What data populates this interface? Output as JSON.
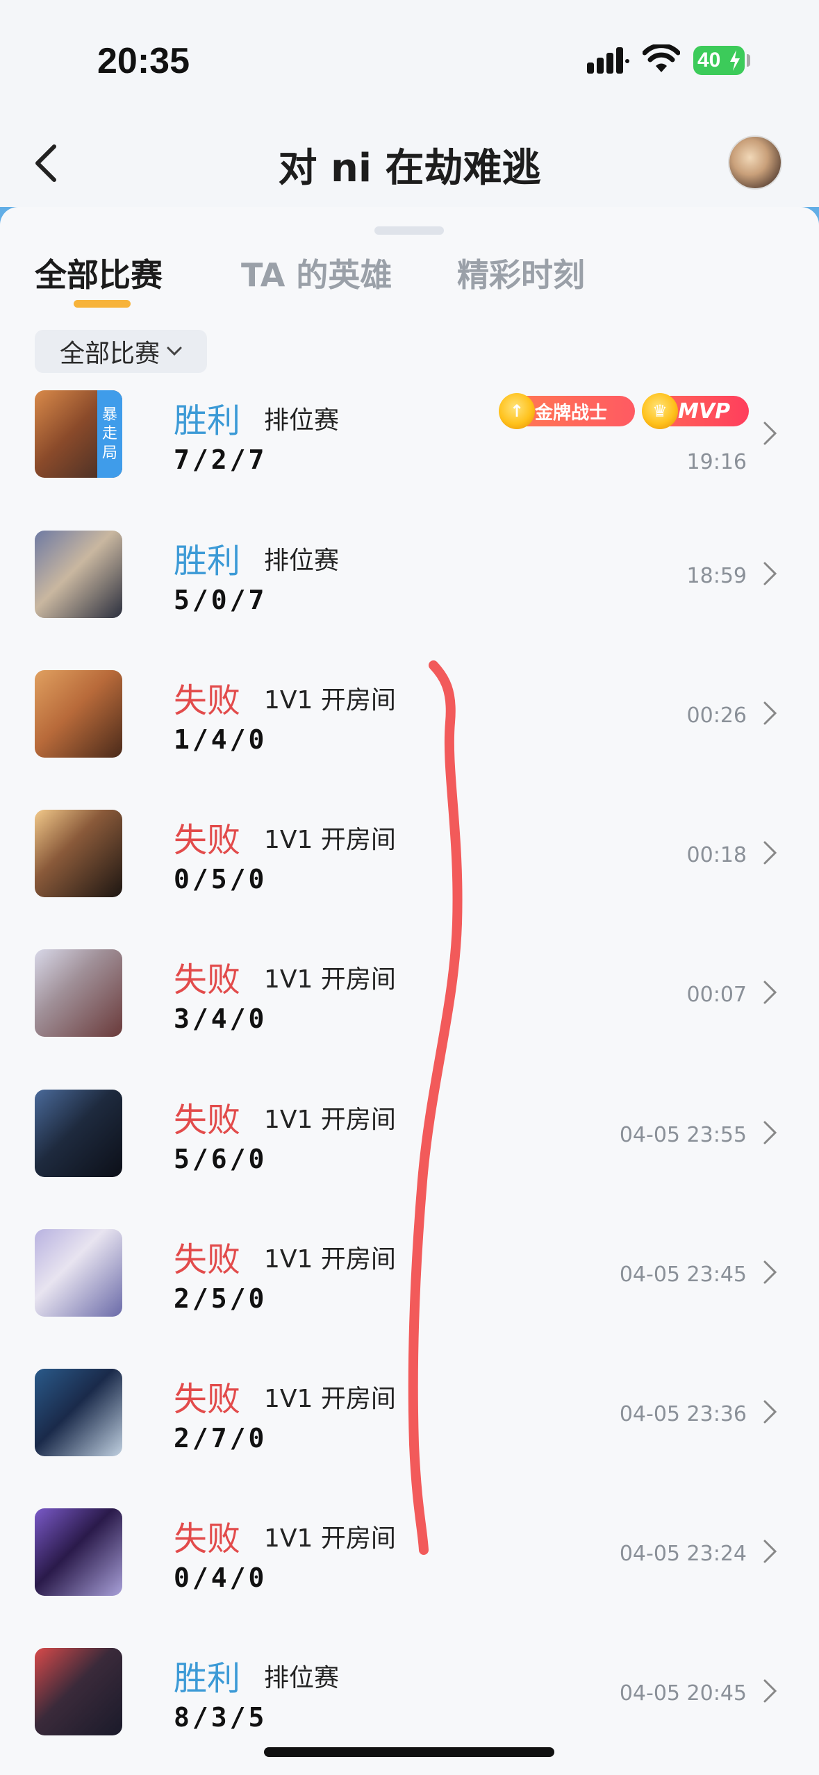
{
  "status_bar": {
    "time": "20:35",
    "battery": "40"
  },
  "header": {
    "title": "对 ni 在劫难逃"
  },
  "tabs": [
    {
      "label": "全部比赛",
      "active": true
    },
    {
      "label": "TA 的英雄",
      "active": false
    },
    {
      "label": "精彩时刻",
      "active": false
    }
  ],
  "filter": {
    "label": "全部比赛"
  },
  "colors": {
    "win": "#3c9ad6",
    "lose": "#e24b4b",
    "accent": "#f7b33a",
    "annotation": "#f25a5a"
  },
  "matches": [
    {
      "result": "胜利",
      "outcome": "win",
      "mode": "排位赛",
      "kda": "7/2/7",
      "time": "19:16",
      "tag": [
        "暴",
        "走",
        "局"
      ],
      "badges": [
        "金牌战士",
        "MVP"
      ]
    },
    {
      "result": "胜利",
      "outcome": "win",
      "mode": "排位赛",
      "kda": "5/0/7",
      "time": "18:59"
    },
    {
      "result": "失败",
      "outcome": "lose",
      "mode": "1V1 开房间",
      "kda": "1/4/0",
      "time": "00:26"
    },
    {
      "result": "失败",
      "outcome": "lose",
      "mode": "1V1 开房间",
      "kda": "0/5/0",
      "time": "00:18"
    },
    {
      "result": "失败",
      "outcome": "lose",
      "mode": "1V1 开房间",
      "kda": "3/4/0",
      "time": "00:07"
    },
    {
      "result": "失败",
      "outcome": "lose",
      "mode": "1V1 开房间",
      "kda": "5/6/0",
      "time": "04-05 23:55"
    },
    {
      "result": "失败",
      "outcome": "lose",
      "mode": "1V1 开房间",
      "kda": "2/5/0",
      "time": "04-05 23:45"
    },
    {
      "result": "失败",
      "outcome": "lose",
      "mode": "1V1 开房间",
      "kda": "2/7/0",
      "time": "04-05 23:36"
    },
    {
      "result": "失败",
      "outcome": "lose",
      "mode": "1V1 开房间",
      "kda": "0/4/0",
      "time": "04-05 23:24"
    },
    {
      "result": "胜利",
      "outcome": "win",
      "mode": "排位赛",
      "kda": "8/3/5",
      "time": "04-05 20:45"
    }
  ]
}
